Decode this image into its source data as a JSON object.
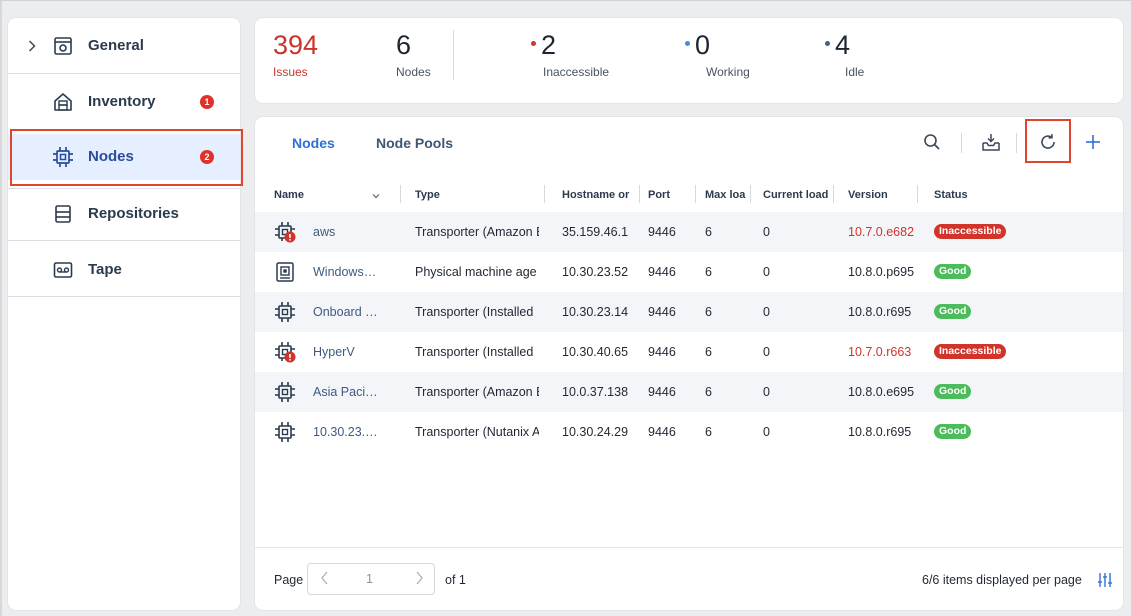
{
  "sidebar": {
    "items": [
      {
        "label": "General",
        "icon": "gear-window-icon",
        "expandable": true
      },
      {
        "label": "Inventory",
        "icon": "inventory-icon",
        "badge": "1"
      },
      {
        "label": "Nodes",
        "icon": "chip-icon",
        "badge": "2",
        "active": true
      },
      {
        "label": "Repositories",
        "icon": "database-icon"
      },
      {
        "label": "Tape",
        "icon": "tape-icon"
      }
    ]
  },
  "summary": {
    "issues": {
      "value": "394",
      "label": "Issues"
    },
    "nodes": {
      "value": "6",
      "label": "Nodes"
    },
    "inaccessible": {
      "value": "2",
      "label": "Inaccessible",
      "color": "#d0342a"
    },
    "working": {
      "value": "0",
      "label": "Working",
      "color": "#3d8ee6"
    },
    "idle": {
      "value": "4",
      "label": "Idle",
      "color": "#4a5e7e"
    }
  },
  "tabs": [
    {
      "label": "Nodes",
      "active": true
    },
    {
      "label": "Node Pools",
      "active": false
    }
  ],
  "toolbar": {
    "search": "search-icon",
    "download": "download-tray-icon",
    "refresh": "refresh-icon",
    "add": "plus-icon"
  },
  "table": {
    "columns": [
      "Name",
      "Type",
      "Hostname or",
      "Port",
      "Max loa",
      "Current load",
      "Version",
      "Status"
    ],
    "rows": [
      {
        "name": "aws",
        "type": "Transporter (Amazon E",
        "hostname": "35.159.46.1",
        "port": "9446",
        "max": "6",
        "current": "0",
        "version": "10.7.0.e682",
        "version_red": true,
        "status": "Inaccessible",
        "icon": "chip-error-icon"
      },
      {
        "name": "Windows…",
        "type": "Physical machine age",
        "hostname": "10.30.23.52",
        "port": "9446",
        "max": "6",
        "current": "0",
        "version": "10.8.0.p695",
        "version_red": false,
        "status": "Good",
        "icon": "chip-agent-icon"
      },
      {
        "name": "Onboard …",
        "type": "Transporter (Installed",
        "hostname": "10.30.23.14",
        "port": "9446",
        "max": "6",
        "current": "0",
        "version": "10.8.0.r695",
        "version_red": false,
        "status": "Good",
        "icon": "chip-icon"
      },
      {
        "name": "HyperV",
        "type": "Transporter (Installed",
        "hostname": "10.30.40.65",
        "port": "9446",
        "max": "6",
        "current": "0",
        "version": "10.7.0.r663",
        "version_red": true,
        "status": "Inaccessible",
        "icon": "chip-error-icon"
      },
      {
        "name": "Asia Paci…",
        "type": "Transporter (Amazon E",
        "hostname": "10.0.37.138",
        "port": "9446",
        "max": "6",
        "current": "0",
        "version": "10.8.0.e695",
        "version_red": false,
        "status": "Good",
        "icon": "chip-icon"
      },
      {
        "name": "10.30.23.…",
        "type": "Transporter (Nutanix A",
        "hostname": "10.30.24.29",
        "port": "9446",
        "max": "6",
        "current": "0",
        "version": "10.8.0.r695",
        "version_red": false,
        "status": "Good",
        "icon": "chip-icon"
      }
    ]
  },
  "status_colors": {
    "Inaccessible": "#d0342a",
    "Good": "#4cbb5c"
  },
  "footer": {
    "page_label": "Page",
    "page_value": "1",
    "of_label": "of 1",
    "items_label": "6/6 items displayed per page"
  }
}
